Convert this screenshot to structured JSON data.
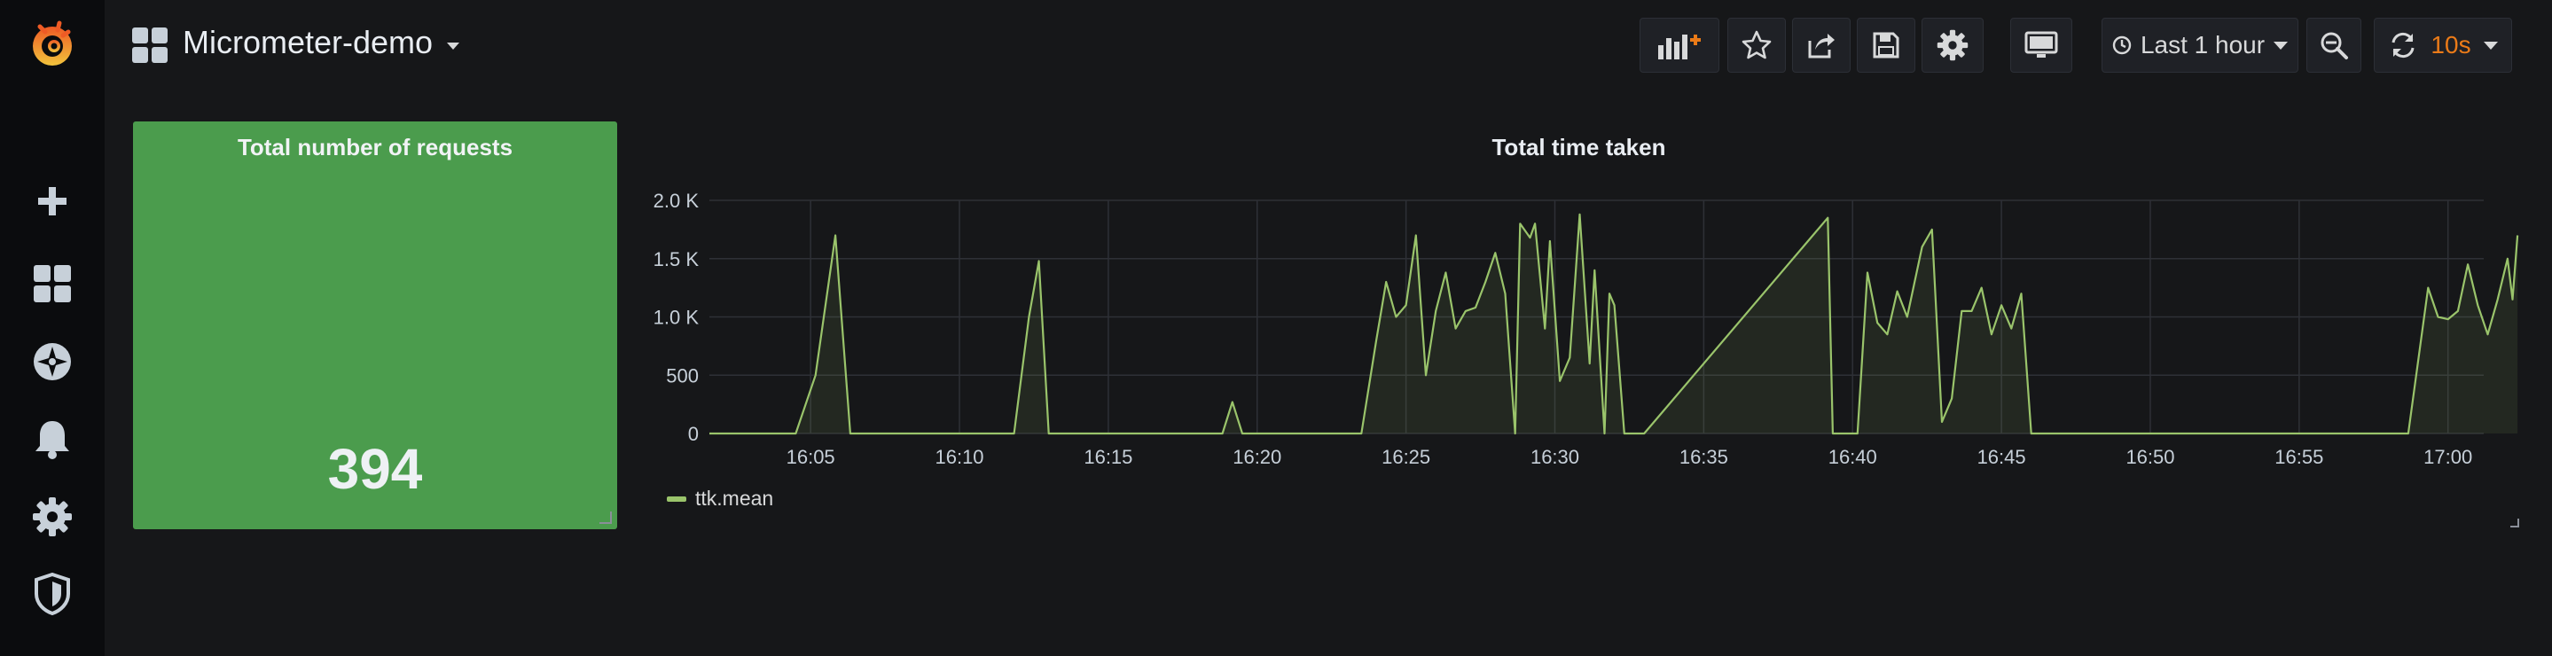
{
  "dashboard": {
    "title": "Micrometer-demo"
  },
  "sidemenu": {
    "items": [
      "grafana-logo",
      "create",
      "dashboards",
      "explore",
      "alerting",
      "configuration",
      "server-admin"
    ]
  },
  "toolbar": {
    "time_range_label": "Last 1 hour",
    "refresh_interval": "10s"
  },
  "panels": {
    "stat": {
      "title": "Total number of requests",
      "value": "394",
      "background": "#4b9c4d"
    },
    "graph": {
      "title": "Total time taken",
      "legend": "ttk.mean",
      "line_color": "#9ac46b"
    }
  },
  "chart_data": {
    "type": "area",
    "title": "Total time taken",
    "xlabel": "",
    "ylabel": "",
    "x_ticks": [
      "16:05",
      "16:10",
      "16:15",
      "16:20",
      "16:25",
      "16:30",
      "16:35",
      "16:40",
      "16:45",
      "16:50",
      "16:55",
      "17:00"
    ],
    "y_ticks": [
      "0",
      "500",
      "1.0 K",
      "1.5 K",
      "2.0 K"
    ],
    "ylim": [
      0,
      2000
    ],
    "x_range_minutes": [
      "16:01:36",
      "17:01:12"
    ],
    "grid": true,
    "legend_position": "bottom-left",
    "series": [
      {
        "name": "ttk.mean",
        "color": "#9ac46b",
        "points": [
          [
            "16:01:36",
            0
          ],
          [
            "16:04:30",
            0
          ],
          [
            "16:05:10",
            500
          ],
          [
            "16:05:50",
            1700
          ],
          [
            "16:06:20",
            0
          ],
          [
            "16:11:50",
            0
          ],
          [
            "16:12:20",
            1000
          ],
          [
            "16:12:40",
            1480
          ],
          [
            "16:13:00",
            0
          ],
          [
            "16:18:50",
            0
          ],
          [
            "16:19:10",
            270
          ],
          [
            "16:19:30",
            0
          ],
          [
            "16:23:30",
            0
          ],
          [
            "16:24:00",
            800
          ],
          [
            "16:24:20",
            1300
          ],
          [
            "16:24:40",
            1000
          ],
          [
            "16:25:00",
            1100
          ],
          [
            "16:25:20",
            1700
          ],
          [
            "16:25:40",
            500
          ],
          [
            "16:26:00",
            1050
          ],
          [
            "16:26:20",
            1380
          ],
          [
            "16:26:40",
            900
          ],
          [
            "16:27:00",
            1050
          ],
          [
            "16:27:20",
            1080
          ],
          [
            "16:27:40",
            1300
          ],
          [
            "16:28:00",
            1550
          ],
          [
            "16:28:20",
            1200
          ],
          [
            "16:28:40",
            0
          ],
          [
            "16:28:50",
            1800
          ],
          [
            "16:29:10",
            1680
          ],
          [
            "16:29:20",
            1800
          ],
          [
            "16:29:40",
            900
          ],
          [
            "16:29:50",
            1650
          ],
          [
            "16:30:10",
            450
          ],
          [
            "16:30:30",
            650
          ],
          [
            "16:30:50",
            1880
          ],
          [
            "16:31:10",
            600
          ],
          [
            "16:31:20",
            1400
          ],
          [
            "16:31:40",
            0
          ],
          [
            "16:31:50",
            1200
          ],
          [
            "16:32:00",
            1100
          ],
          [
            "16:32:20",
            0
          ],
          [
            "16:33:00",
            0
          ],
          [
            "16:39:10",
            1850
          ],
          [
            "16:39:20",
            0
          ],
          [
            "16:40:10",
            0
          ],
          [
            "16:40:30",
            1380
          ],
          [
            "16:40:50",
            950
          ],
          [
            "16:41:10",
            850
          ],
          [
            "16:41:30",
            1220
          ],
          [
            "16:41:50",
            1000
          ],
          [
            "16:42:20",
            1600
          ],
          [
            "16:42:40",
            1750
          ],
          [
            "16:43:00",
            100
          ],
          [
            "16:43:20",
            300
          ],
          [
            "16:43:40",
            1050
          ],
          [
            "16:44:00",
            1050
          ],
          [
            "16:44:20",
            1250
          ],
          [
            "16:44:40",
            850
          ],
          [
            "16:45:00",
            1100
          ],
          [
            "16:45:20",
            900
          ],
          [
            "16:45:40",
            1200
          ],
          [
            "16:46:00",
            0
          ],
          [
            "16:58:40",
            0
          ],
          [
            "16:59:20",
            1250
          ],
          [
            "16:59:40",
            1000
          ],
          [
            "17:00:00",
            980
          ],
          [
            "17:00:20",
            1050
          ],
          [
            "17:00:40",
            1450
          ],
          [
            "17:01:00",
            1100
          ],
          [
            "17:01:20",
            850
          ],
          [
            "17:01:40",
            1150
          ],
          [
            "17:02:00",
            1500
          ],
          [
            "17:02:10",
            1150
          ],
          [
            "17:02:20",
            1700
          ]
        ]
      }
    ]
  }
}
